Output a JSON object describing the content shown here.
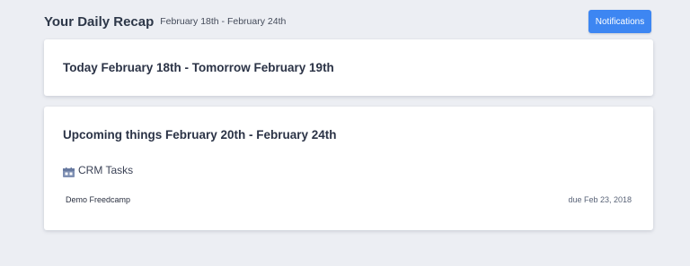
{
  "header": {
    "title": "Your Daily Recap",
    "date_range": "February 18th - February 24th",
    "notifications_label": "Notifications"
  },
  "today": {
    "title": "Today February 18th - Tomorrow February 19th"
  },
  "upcoming": {
    "title": "Upcoming things February 20th - February 24th",
    "sections": [
      {
        "icon": "crm-tasks-icon",
        "label": "CRM Tasks",
        "tasks": [
          {
            "name": "Demo Freedcamp",
            "due": "due Feb 23, 2018"
          }
        ]
      }
    ]
  },
  "colors": {
    "background": "#eceef3",
    "accent": "#3d86f2",
    "icon": "#7f90b3"
  }
}
